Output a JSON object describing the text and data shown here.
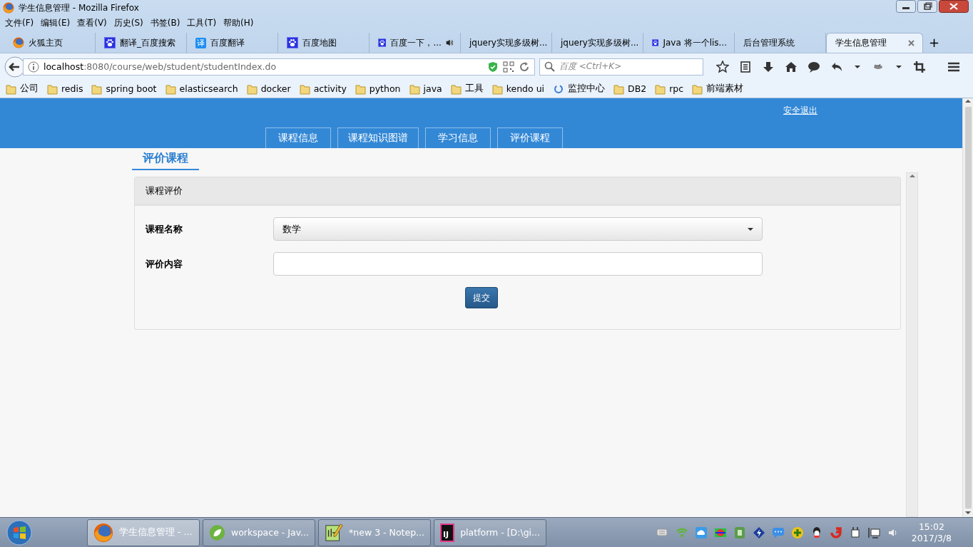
{
  "window": {
    "title": "学生信息管理 - Mozilla Firefox"
  },
  "menu": [
    "文件(F)",
    "编辑(E)",
    "查看(V)",
    "历史(S)",
    "书签(B)",
    "工具(T)",
    "帮助(H)"
  ],
  "browser_tabs": [
    {
      "label": "火狐主页",
      "kind": "firefox",
      "selected": false
    },
    {
      "label": "翻译_百度搜索",
      "kind": "paw",
      "selected": false
    },
    {
      "label": "百度翻译",
      "kind": "letter",
      "icon_text": "译",
      "selected": false
    },
    {
      "label": "百度地图",
      "kind": "paw",
      "selected": false
    },
    {
      "label": "百度一下，...",
      "kind": "paw",
      "audio": true,
      "selected": false
    },
    {
      "label": "jquery实现多级树...",
      "kind": "plain",
      "selected": false
    },
    {
      "label": "jquery实现多级树...",
      "kind": "plain",
      "selected": false
    },
    {
      "label": "Java 将一个lis...",
      "kind": "paw",
      "selected": false
    },
    {
      "label": "后台管理系统",
      "kind": "plain",
      "selected": false
    },
    {
      "label": "学生信息管理",
      "kind": "plain",
      "selected": true
    }
  ],
  "new_tab": "+",
  "address": {
    "host": "localhost",
    "path": ":8080/course/web/student/studentIndex.do"
  },
  "search": {
    "placeholder": "百度 <Ctrl+K>"
  },
  "bookmarks": [
    {
      "label": "公司",
      "kind": "folder"
    },
    {
      "label": "redis",
      "kind": "folder"
    },
    {
      "label": "spring boot",
      "kind": "folder"
    },
    {
      "label": "elasticsearch",
      "kind": "folder"
    },
    {
      "label": "docker",
      "kind": "folder"
    },
    {
      "label": "activity",
      "kind": "folder"
    },
    {
      "label": "python",
      "kind": "folder"
    },
    {
      "label": "java",
      "kind": "folder"
    },
    {
      "label": "工具",
      "kind": "folder"
    },
    {
      "label": "kendo ui",
      "kind": "folder"
    },
    {
      "label": "监控中心",
      "kind": "site"
    },
    {
      "label": "DB2",
      "kind": "folder"
    },
    {
      "label": "rpc",
      "kind": "folder"
    },
    {
      "label": "前端素材",
      "kind": "folder"
    }
  ],
  "page": {
    "logout": "安全退出",
    "nav": [
      {
        "label": "课程信息"
      },
      {
        "label": "课程知识图谱"
      },
      {
        "label": "学习信息"
      },
      {
        "label": "评价课程"
      }
    ],
    "section_tabs": [
      {
        "label": "评价课程",
        "selected": true
      }
    ],
    "panel": {
      "title": "课程评价",
      "fields": [
        {
          "label": "课程名称",
          "kind": "select",
          "value": "数学"
        },
        {
          "label": "评价内容",
          "kind": "text"
        }
      ],
      "submit": "提交"
    }
  },
  "taskbar": {
    "buttons": [
      {
        "label": "学生信息管理 - ...",
        "kind": "firefox",
        "selected": true
      },
      {
        "label": "workspace - Jav...",
        "kind": "leaf",
        "selected": false
      },
      {
        "label": "*new 3 - Notep...",
        "kind": "notepad",
        "selected": false
      },
      {
        "label": "platform - [D:\\gi...",
        "kind": "ij",
        "icon_text": "IJ",
        "selected": false
      }
    ],
    "time": "15:02",
    "date": "2017/3/8"
  }
}
